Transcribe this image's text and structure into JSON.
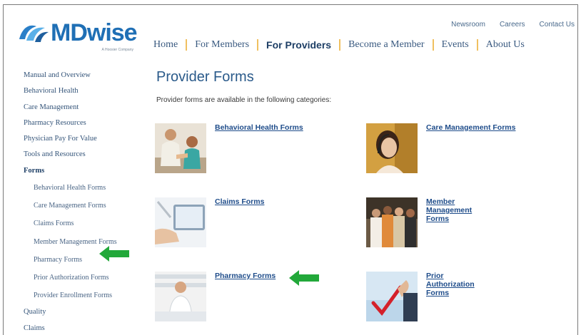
{
  "brand": {
    "name": "MDwise",
    "tagline": "A Hoosier Company",
    "primary_color": "#1f6fb5"
  },
  "utility_nav": [
    "Newsroom",
    "Careers",
    "Contact Us"
  ],
  "main_nav": [
    {
      "label": "Home",
      "active": false
    },
    {
      "label": "For Members",
      "active": false
    },
    {
      "label": "For Providers",
      "active": true
    },
    {
      "label": "Become a Member",
      "active": false
    },
    {
      "label": "Events",
      "active": false
    },
    {
      "label": "About Us",
      "active": false
    }
  ],
  "sidebar": {
    "items": [
      {
        "label": "Manual and Overview"
      },
      {
        "label": "Behavioral Health"
      },
      {
        "label": "Care Management"
      },
      {
        "label": "Pharmacy Resources"
      },
      {
        "label": "Physician Pay For Value"
      },
      {
        "label": "Tools and Resources"
      },
      {
        "label": "Forms"
      }
    ],
    "sub_items": [
      {
        "label": "Behavioral Health Forms"
      },
      {
        "label": "Care Management Forms"
      },
      {
        "label": "Claims Forms"
      },
      {
        "label": "Member Management Forms"
      },
      {
        "label": "Pharmacy Forms"
      },
      {
        "label": "Prior Authorization Forms"
      },
      {
        "label": "Provider Enrollment Forms"
      }
    ],
    "after_items": [
      {
        "label": "Quality"
      },
      {
        "label": "Claims"
      }
    ]
  },
  "content": {
    "title": "Provider Forms",
    "intro": "Provider forms are available in the following categories:",
    "cards": [
      {
        "label": "Behavioral Health Forms",
        "icon": "counseling-photo"
      },
      {
        "label": "Care Management Forms",
        "icon": "headset-agent-photo"
      },
      {
        "label": "Claims Forms",
        "icon": "tablet-photo"
      },
      {
        "label": "Member\nManagement Forms",
        "icon": "group-photo"
      },
      {
        "label": "Pharmacy Forms",
        "icon": "pharmacist-photo"
      },
      {
        "label": "Prior\nAuthorization Forms",
        "icon": "checkmark-photo"
      }
    ]
  },
  "annotations": {
    "arrow_color": "#22a83a"
  }
}
